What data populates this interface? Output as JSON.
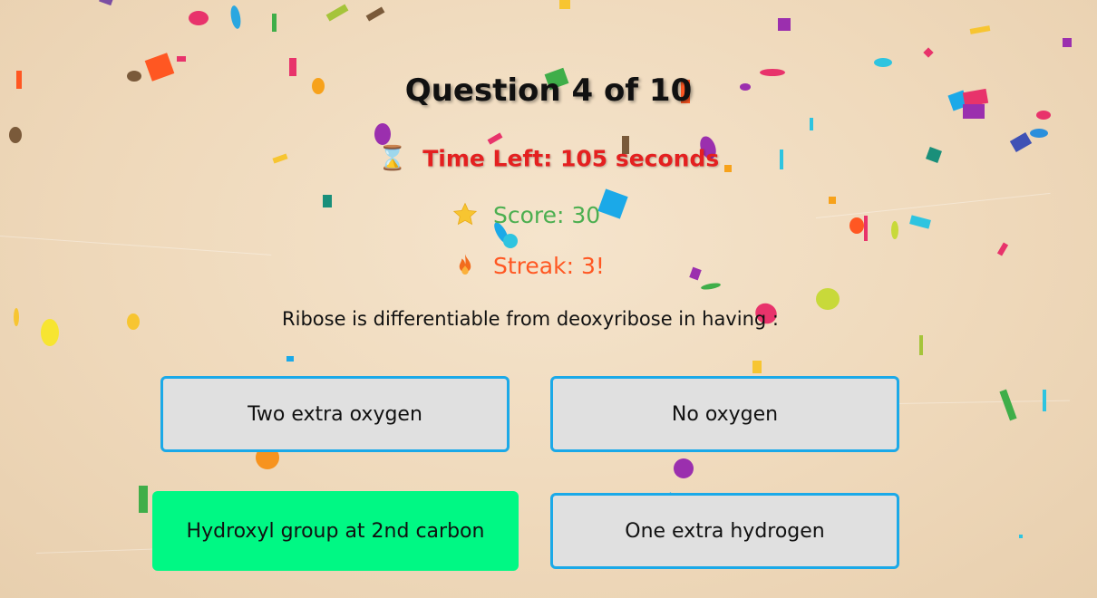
{
  "quiz": {
    "title": "Question 4 of 10",
    "timer": {
      "icon": "hourglass-icon",
      "text": "Time Left: 105 seconds"
    },
    "score": {
      "icon": "star-icon",
      "text": "Score: 30"
    },
    "streak": {
      "icon": "fire-icon",
      "text": "Streak: 3!"
    },
    "question": "Ribose is differentiable from deoxyribose in having :",
    "answers": [
      {
        "label": "Two extra oxygen",
        "state": "default"
      },
      {
        "label": "No oxygen",
        "state": "default"
      },
      {
        "label": "Hydroxyl group at 2nd carbon",
        "state": "correct"
      },
      {
        "label": "One extra hydrogen",
        "state": "default"
      }
    ]
  },
  "colors": {
    "background": "#efd9bb",
    "timer": "#e42020",
    "score": "#4caf50",
    "streak": "#ff5722",
    "answer_border": "#1ba9e8",
    "answer_bg": "#e0e0e0",
    "correct_bg": "#00f884"
  }
}
